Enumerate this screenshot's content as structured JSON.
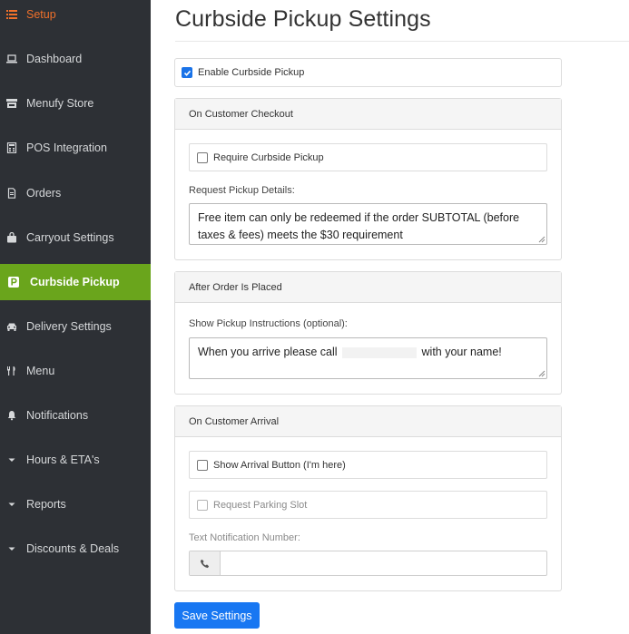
{
  "sidebar": {
    "items": [
      {
        "label": "Setup",
        "icon": "list-icon"
      },
      {
        "label": "Dashboard",
        "icon": "laptop-icon"
      },
      {
        "label": "Menufy Store",
        "icon": "store-icon"
      },
      {
        "label": "POS Integration",
        "icon": "calculator-icon"
      },
      {
        "label": "Orders",
        "icon": "file-icon"
      },
      {
        "label": "Carryout Settings",
        "icon": "shopping-bag-icon"
      },
      {
        "label": "Curbside Pickup",
        "icon": "parking-icon"
      },
      {
        "label": "Delivery Settings",
        "icon": "car-icon"
      },
      {
        "label": "Menu",
        "icon": "utensils-icon"
      },
      {
        "label": "Notifications",
        "icon": "bell-icon"
      },
      {
        "label": "Hours & ETA's",
        "icon": "caret-down-icon"
      },
      {
        "label": "Reports",
        "icon": "caret-down-icon"
      },
      {
        "label": "Discounts & Deals",
        "icon": "caret-down-icon"
      }
    ],
    "active_color": "#6aa51c",
    "setup_color": "#f0702a"
  },
  "page": {
    "title": "Curbside Pickup Settings"
  },
  "enable": {
    "label": "Enable Curbside Pickup",
    "checked": true
  },
  "checkout": {
    "heading": "On Customer Checkout",
    "require_label": "Require Curbside Pickup",
    "details_label": "Request Pickup Details:",
    "details_value": "Free item can only be redeemed if the order SUBTOTAL (before taxes & fees) meets the $30 requirement"
  },
  "after_order": {
    "heading": "After Order Is Placed",
    "instructions_label": "Show Pickup Instructions (optional):",
    "instructions_before": "When you arrive please call",
    "instructions_after": "with your name!"
  },
  "arrival": {
    "heading": "On Customer Arrival",
    "arrival_button_label": "Show Arrival Button (I'm here)",
    "parking_label": "Request Parking Slot",
    "text_number_label": "Text Notification Number:",
    "text_number_value": ""
  },
  "save_label": "Save Settings",
  "accent_color": "#1877f2"
}
